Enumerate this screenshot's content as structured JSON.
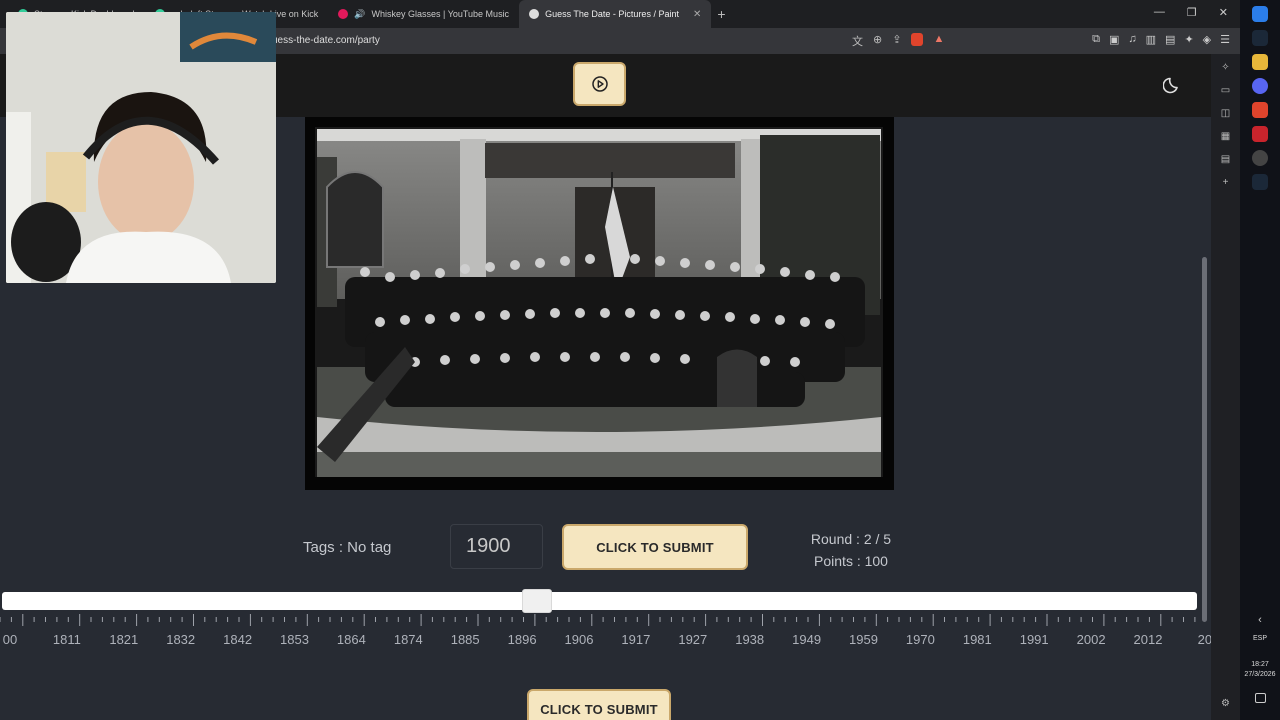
{
  "browser": {
    "tabs": [
      {
        "label": "Stream - Kick Dashboard",
        "active": false
      },
      {
        "label": "nelodeft Stream - Watch Live on Kick",
        "active": false
      },
      {
        "label": "Whiskey Glasses | YouTube Music",
        "active": false
      },
      {
        "label": "Guess The Date - Pictures / Paint",
        "active": true
      }
    ],
    "url": "uess-the-date.com/party"
  },
  "game": {
    "tags_text": "Tags : No tag",
    "year_value": "1900",
    "submit_label": "CLICK TO SUBMIT",
    "round_text": "Round : 2 / 5",
    "points_text": "Points : 100",
    "bottom_submit_label": "CLICK TO SUBMIT",
    "slider_value": 1900,
    "timeline_labels": [
      "00",
      "1811",
      "1821",
      "1832",
      "1842",
      "1853",
      "1864",
      "1874",
      "1885",
      "1896",
      "1906",
      "1917",
      "1927",
      "1938",
      "1949",
      "1959",
      "1970",
      "1981",
      "1991",
      "2002",
      "2012",
      "20"
    ]
  },
  "taskbar": {
    "lang": "ESP",
    "time": "18:27",
    "date": "27/3/2026"
  },
  "icons": [
    "play-icon",
    "moon-icon",
    "translate-icon",
    "zoom-icon",
    "share-icon",
    "brave-shield-icon",
    "extensions-icon",
    "settings-icon"
  ],
  "colors": {
    "page_bg": "#272b33",
    "header_bg": "#1a1a1a",
    "button_bg": "#f5e6c0",
    "button_border": "#caa86b",
    "slider_track": "#ffffff"
  }
}
